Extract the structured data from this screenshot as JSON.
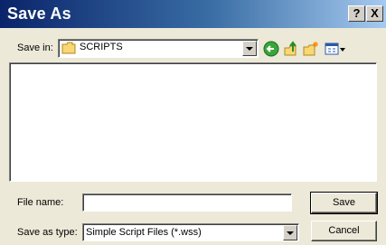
{
  "window": {
    "title": "Save As",
    "help_button": "?",
    "close_button": "X"
  },
  "toolbar": {
    "save_in_label": "Save in:",
    "save_in_value": "SCRIPTS",
    "icons": [
      "back-icon",
      "up-folder-icon",
      "new-folder-icon",
      "view-menu-icon"
    ]
  },
  "file_list": {
    "items": []
  },
  "form": {
    "file_name_label": "File name:",
    "file_name_value": "",
    "save_as_type_label": "Save as type:",
    "save_as_type_value": "Simple Script Files (*.wss)"
  },
  "buttons": {
    "save_label": "Save",
    "cancel_label": "Cancel"
  },
  "colors": {
    "title_gradient_start": "#0a246a",
    "title_gradient_end": "#a6caf0",
    "face": "#ece9d8"
  }
}
